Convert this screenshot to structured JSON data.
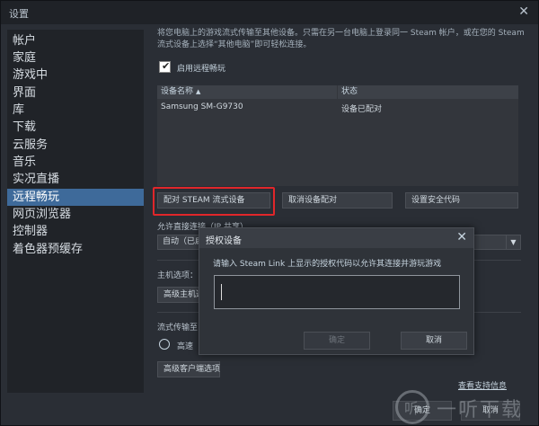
{
  "window": {
    "title": "设置",
    "close_glyph": "✕"
  },
  "sidebar": {
    "items": [
      {
        "label": "帐户"
      },
      {
        "label": "家庭"
      },
      {
        "label": "游戏中"
      },
      {
        "label": "界面"
      },
      {
        "label": "库"
      },
      {
        "label": "下载"
      },
      {
        "label": "云服务"
      },
      {
        "label": "音乐"
      },
      {
        "label": "实况直播"
      },
      {
        "label": "远程畅玩",
        "active": true
      },
      {
        "label": "网页浏览器"
      },
      {
        "label": "控制器"
      },
      {
        "label": "着色器预缓存"
      }
    ]
  },
  "main": {
    "intro": "将您电脑上的游戏流式传输至其他设备。只需在另一台电脑上登录同一 Steam 帐户，或在您的 Steam 流式设备上选择“其他电脑”即可轻松连接。",
    "enable_checkbox": {
      "label": "启用远程畅玩",
      "checked": true
    },
    "device_table": {
      "headers": {
        "name": "设备名称",
        "status": "状态"
      },
      "rows": [
        {
          "name": "Samsung SM-G9730",
          "status": "设备已配对"
        }
      ]
    },
    "buttons": {
      "pair": "配对 STEAM 流式设备",
      "unpair": "取消设备配对",
      "security_code": "设置安全代码"
    },
    "direct_connect": {
      "label": "允许直接连接（IP 共享）",
      "value": "自动（已启"
    },
    "host_options": {
      "label": "主机选项：",
      "advanced_button": "高级主机选"
    },
    "streaming": {
      "label": "流式传输至",
      "radio_label": "高速"
    },
    "advanced_client_button": "高级客户端选项",
    "support_link": "查看支持信息"
  },
  "footer": {
    "ok": "确定",
    "cancel": "取消"
  },
  "dialog": {
    "title": "授权设备",
    "close_glyph": "✕",
    "message": "请输入 Steam Link 上显示的授权代码以允许其连接并游玩游戏",
    "input_value": "",
    "ok": "确定",
    "cancel": "取消"
  },
  "watermark": {
    "glyph": "听",
    "text": "一听下载"
  },
  "colors": {
    "active": "#3e6a9a",
    "highlight": "#e0262a",
    "bg": "#2a2e35"
  }
}
